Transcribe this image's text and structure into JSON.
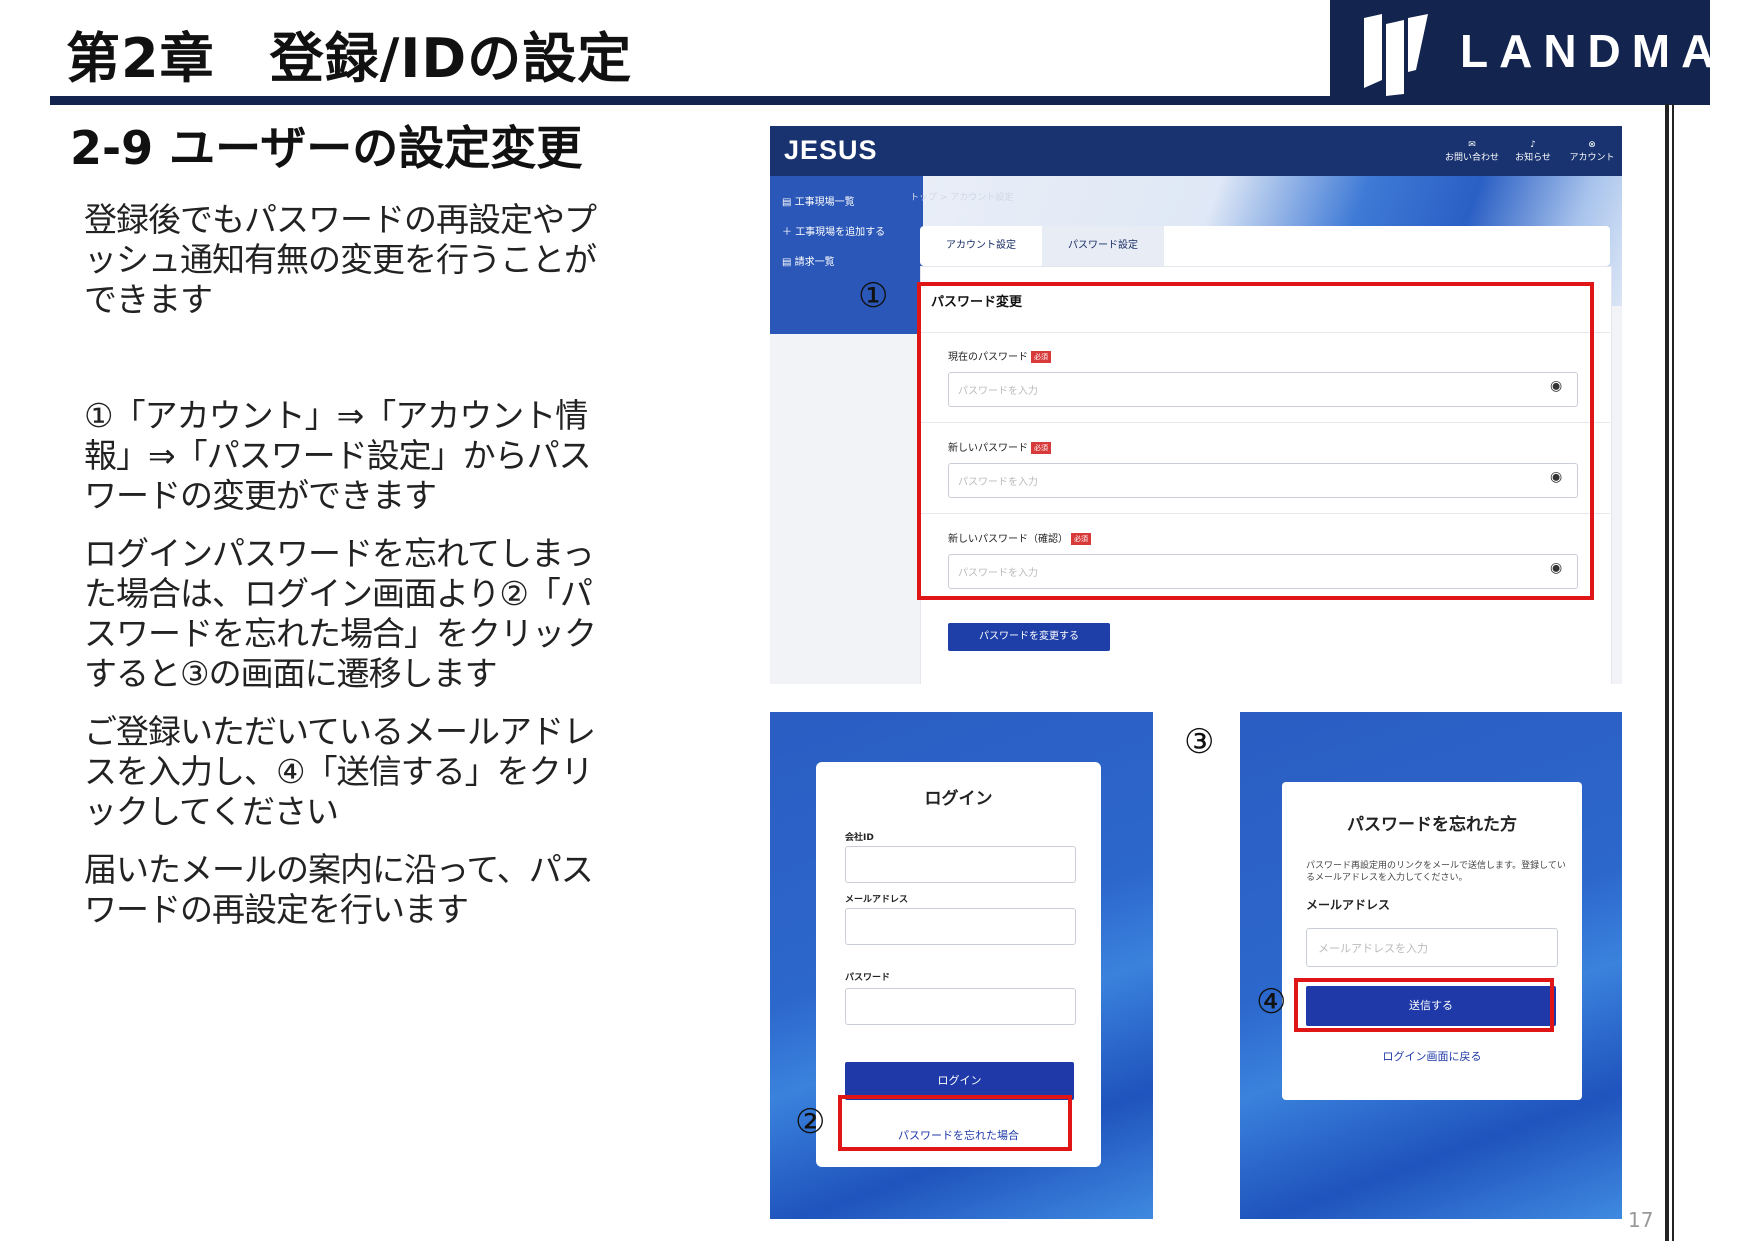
{
  "header": {
    "chapter_title": "第2章　登録/IDの設定",
    "logo_text": "LANDMARK"
  },
  "section_title": "2-9  ユーザーの設定変更",
  "paragraphs": [
    "登録後でもパスワードの再設定やプッシュ通知有無の変更を行うことができます",
    "①「アカウント」⇒「アカウント情報」⇒「パスワード設定」からパスワードの変更ができます",
    "ログインパスワードを忘れてしまった場合は、ログイン画面より②「パスワードを忘れた場合」をクリックすると③の画面に遷移します",
    "ご登録いただいているメールアドレスを入力し、④「送信する」をクリックしてください",
    "届いたメールの案内に沿って、パスワードの再設定を行います"
  ],
  "page_number": "17",
  "markers": [
    "①",
    "②",
    "③",
    "④"
  ],
  "account_screen": {
    "app_logo": "JESUS",
    "nav": [
      "お問い合わせ",
      "お知らせ",
      "アカウント"
    ],
    "sidebar": [
      "工事現場一覧",
      "工事現場を追加する",
      "請求一覧"
    ],
    "breadcrumb": "トップ  >  アカウント設定",
    "tabs": [
      "アカウント設定",
      "パスワード設定"
    ],
    "panel_title": "パスワード変更",
    "required_badge": "必須",
    "fields": [
      {
        "label": "現在のパスワード",
        "placeholder": "パスワードを入力"
      },
      {
        "label": "新しいパスワード",
        "placeholder": "パスワードを入力"
      },
      {
        "label": "新しいパスワード（確認）",
        "placeholder": "パスワードを入力"
      }
    ],
    "submit": "パスワードを変更する"
  },
  "login_screen": {
    "title": "ログイン",
    "labels": [
      "会社ID",
      "メールアドレス",
      "パスワード"
    ],
    "button": "ログイン",
    "forgot_link": "パスワードを忘れた場合"
  },
  "forgot_screen": {
    "title": "パスワードを忘れた方",
    "description": "パスワード再設定用のリンクをメールで送信します。登録しているメールアドレスを入力してください。",
    "email_label": "メールアドレス",
    "email_placeholder": "メールアドレスを入力",
    "send_button": "送信する",
    "back_link": "ログイン画面に戻る"
  },
  "colors": {
    "navy": "#13244f",
    "highlight_red": "#e01616",
    "button_blue": "#1f3aa8"
  }
}
